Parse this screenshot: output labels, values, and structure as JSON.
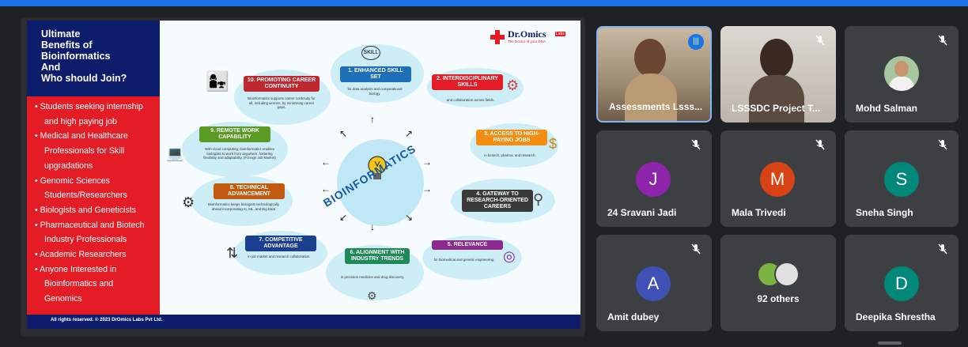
{
  "slide": {
    "title": "Ultimate\nBenefits of\nBioinformatics\nAnd\nWho should Join?",
    "audience": [
      "• Students seeking internship",
      "  and high paying job",
      "• Medical and Healthcare",
      "  Professionals for Skill",
      "  upgradations",
      "• Genomic Sciences",
      "  Students/Researchers",
      "• Biologists and Geneticists",
      "• Pharmaceutical and Biotech",
      "  Industry Professionals",
      "• Academic Researchers",
      "• Anyone Interested in",
      "  Bioinformatics and",
      "  Genomics"
    ],
    "footer": "All rights reserved. © 2023 DrOmics Labs Pvt Ltd.",
    "logo_name": "Dr.Omics",
    "logo_badge": "Labs",
    "logo_tagline": "The Doctor of your DNA",
    "center": "BIOINFORMATICS",
    "benefits": [
      {
        "title": "1. ENHANCED SKILL SET",
        "desc": "for data analysis and computational biology.",
        "color": "#1e6fb8"
      },
      {
        "title": "2. INTERDISCIPLINARY SKILLS",
        "desc": "and collaboration across fields.",
        "color": "#e31c25"
      },
      {
        "title": "3. ACCESS TO HIGH-PAYING JOBS",
        "desc": "in biotech, pharma, and research.",
        "color": "#f28c12"
      },
      {
        "title": "4. GATEWAY TO RESEARCH-ORIENTED CAREERS",
        "desc": "",
        "color": "#3a3a3a"
      },
      {
        "title": "5. RELEVANCE",
        "desc": "for biomedical and genetic engineering.",
        "color": "#8e2a8e"
      },
      {
        "title": "6. ALIGNMENT WITH INDUSTRY TRENDS",
        "desc": "in precision medicine and drug discovery.",
        "color": "#1f8a57"
      },
      {
        "title": "7. COMPETITIVE ADVANTAGE",
        "desc": "in job market and research collaboration.",
        "color": "#1b3f8f"
      },
      {
        "title": "8. TECHNICAL ADVANCEMENT",
        "desc": "Bioinformatics keeps biologists technologically ahead incorporating AI, ML, and Big Data",
        "color": "#c25b10"
      },
      {
        "title": "9. REMOTE WORK CAPABILITY",
        "desc": "With cloud computing, bioinformatics enables biologists to work from anywhere, fostering flexibility and adaptability. (Foreign Job Market)",
        "color": "#5a9a25"
      },
      {
        "title": "10. PROMOTING CAREER CONTINUITY",
        "desc": "Bioinformatics supports career continuity for all, including women, by minimising career gaps.",
        "color": "#c0282f"
      }
    ],
    "skill_icon_text": "SKILL"
  },
  "participants": [
    {
      "name": "Assessments Lsss...",
      "type": "video",
      "speaking": true
    },
    {
      "name": "LSSSDC Project T...",
      "type": "video",
      "muted": true
    },
    {
      "name": "Mohd Salman",
      "type": "photo",
      "muted": true
    },
    {
      "name": "24 Sravani Jadi",
      "initial": "J",
      "color": "#8e24aa",
      "muted": true
    },
    {
      "name": "Mala Trivedi",
      "initial": "M",
      "color": "#d84315",
      "muted": true
    },
    {
      "name": "Sneha Singh",
      "initial": "S",
      "color": "#00897b",
      "muted": true
    },
    {
      "name": "Amit dubey",
      "initial": "A",
      "color": "#3f51b5",
      "muted": true
    },
    {
      "name": "92 others",
      "type": "others"
    },
    {
      "name": "Deepika Shrestha",
      "initial": "D",
      "color": "#00897b",
      "muted": true
    }
  ]
}
